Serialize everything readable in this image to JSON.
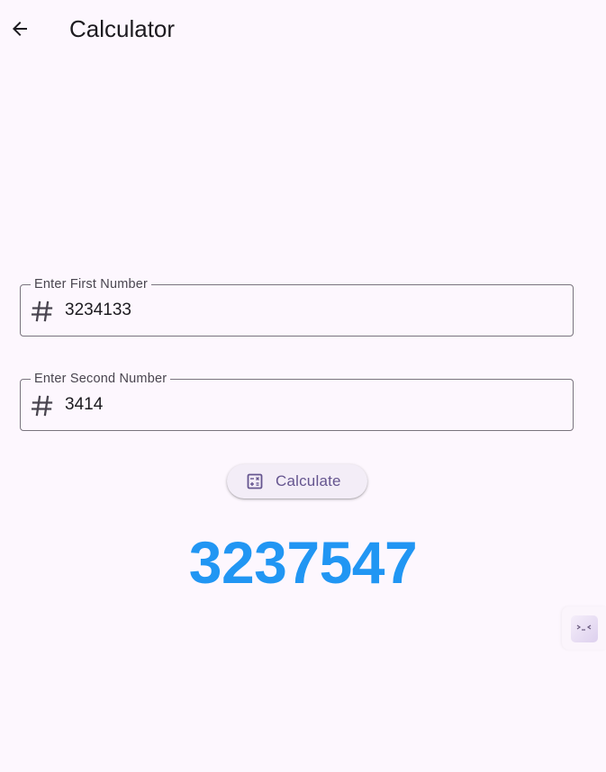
{
  "app_bar": {
    "title": "Calculator",
    "back_icon": "arrow-back-icon"
  },
  "first_field": {
    "label": "Enter First Number",
    "value": "3234133",
    "icon": "hash-icon"
  },
  "second_field": {
    "label": "Enter Second Number",
    "value": "3414",
    "icon": "hash-icon"
  },
  "calculate_button": {
    "label": "Calculate",
    "icon": "calculator-icon"
  },
  "result": {
    "value": "3237547"
  },
  "side_tab": {
    "icon": "debug-overlay-icon"
  },
  "colors": {
    "background": "#fdf7fe",
    "result": "#2196f3",
    "button_bg": "#f3edf7",
    "button_text": "#65558f",
    "outline": "#79747e"
  }
}
